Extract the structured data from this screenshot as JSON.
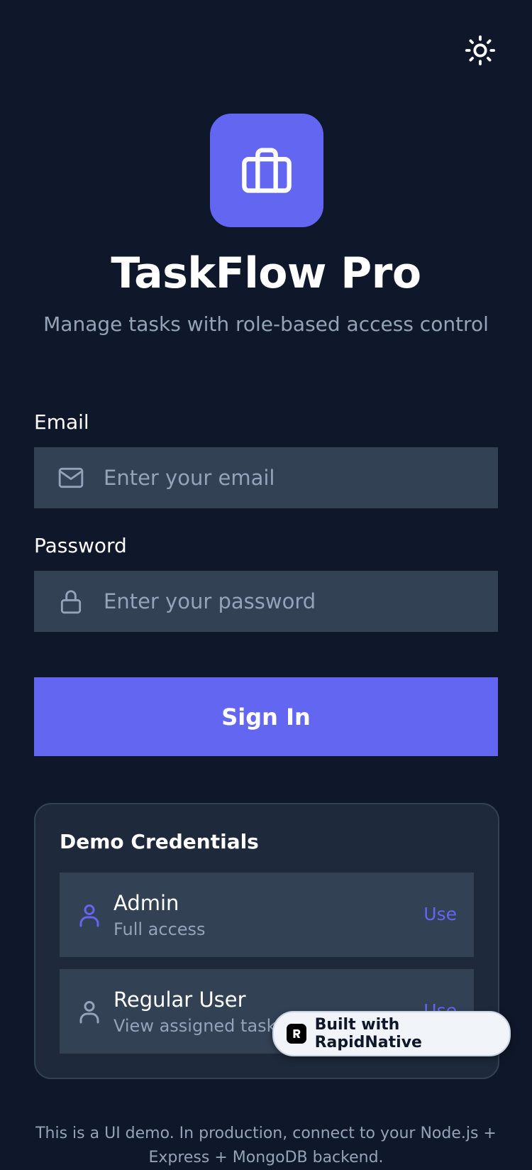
{
  "header": {
    "theme_toggle_icon": "sun-icon"
  },
  "brand": {
    "logo_icon": "briefcase-icon",
    "title": "TaskFlow Pro",
    "subtitle": "Manage tasks with role-based access control",
    "accent": "#6366f1"
  },
  "form": {
    "email_label": "Email",
    "email_placeholder": "Enter your email",
    "email_value": "",
    "email_icon": "mail-icon",
    "password_label": "Password",
    "password_placeholder": "Enter your password",
    "password_value": "",
    "password_icon": "lock-icon",
    "submit_label": "Sign In"
  },
  "demo": {
    "title": "Demo Credentials",
    "items": [
      {
        "name": "Admin",
        "description": "Full access",
        "action": "Use",
        "icon": "user-icon",
        "icon_color": "#6366f1"
      },
      {
        "name": "Regular User",
        "description": "View assigned tasks",
        "action": "Use",
        "icon": "user-icon",
        "icon_color": "#94a3b8"
      }
    ]
  },
  "badge": {
    "label": "Built with RapidNative"
  },
  "footer": {
    "note": "This is a UI demo. In production, connect to your Node.js + Express + MongoDB backend."
  },
  "colors": {
    "background": "#0f172a",
    "input_bg": "#334155",
    "card_bg": "#1e293b",
    "muted_text": "#94a3b8"
  }
}
